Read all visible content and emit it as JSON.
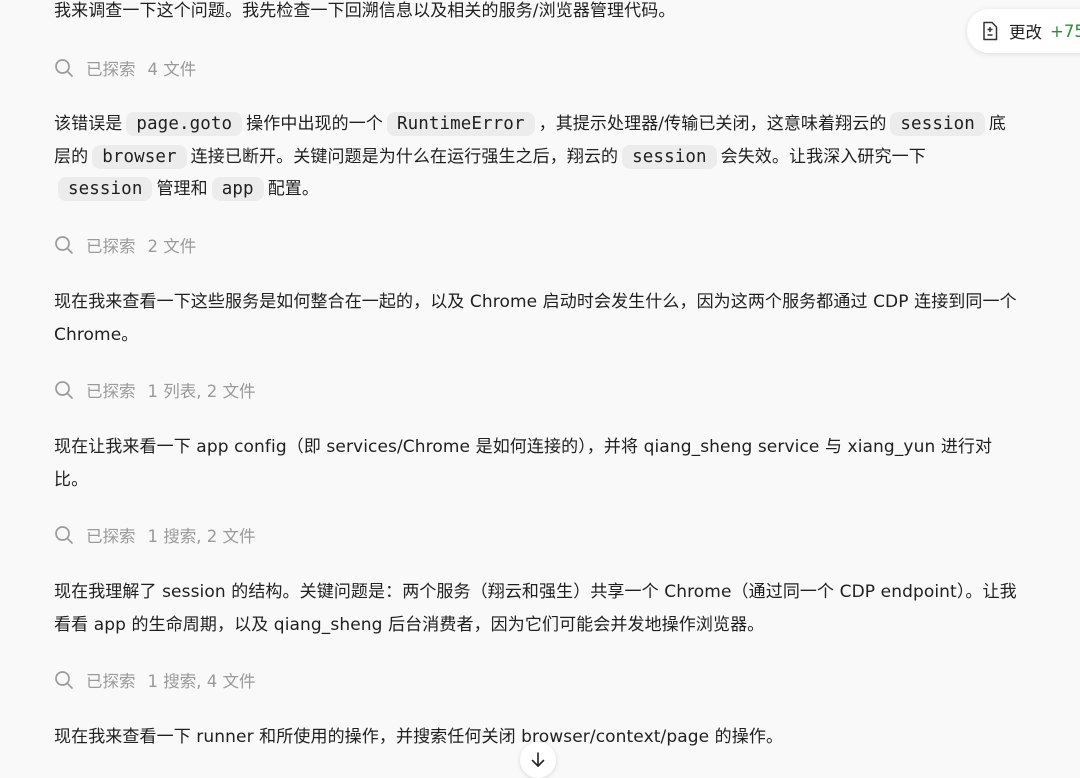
{
  "messages": [
    {
      "parts": [
        {
          "t": "我来调查一下这个问题。我先检查一下回溯信息以及相关的服务/浏览器管理代码。"
        }
      ]
    },
    {
      "parts": [
        {
          "t": "该错误是"
        },
        {
          "c": "page.goto"
        },
        {
          "t": "操作中出现的一个"
        },
        {
          "c": "RuntimeError"
        },
        {
          "t": "，其提示处理器/传输已关闭，这意味着翔云的"
        },
        {
          "c": "session"
        },
        {
          "t": "底层的"
        },
        {
          "c": "browser"
        },
        {
          "t": "连接已断开。关键问题是为什么在运行强生之后，翔云的"
        },
        {
          "c": "session"
        },
        {
          "t": "会失效。让我深入研究一下"
        },
        {
          "c": "session"
        },
        {
          "t": "管理和"
        },
        {
          "c": "app"
        },
        {
          "t": "配置。"
        }
      ]
    },
    {
      "parts": [
        {
          "t": "现在我来查看一下这些服务是如何整合在一起的，以及 Chrome 启动时会发生什么，因为这两个服务都通过 CDP 连接到同一个 Chrome。"
        }
      ]
    },
    {
      "parts": [
        {
          "t": "现在让我来看一下 app config（即 services/Chrome 是如何连接的），并将 qiang_sheng service 与 xiang_yun 进行对比。"
        }
      ]
    },
    {
      "parts": [
        {
          "t": "现在我理解了 session 的结构。关键问题是：两个服务（翔云和强生）共享一个 Chrome（通过同一个 CDP endpoint）。让我看看 app 的生命周期，以及 qiang_sheng 后台消费者，因为它们可能会并发地操作浏览器。"
        }
      ]
    },
    {
      "parts": [
        {
          "t": "现在我来查看一下 runner 和所使用的操作，并搜索任何关闭 browser/context/page 的操作。"
        }
      ]
    }
  ],
  "explorations": [
    {
      "label": "已探索",
      "detail": "4 文件"
    },
    {
      "label": "已探索",
      "detail": "2 文件"
    },
    {
      "label": "已探索",
      "detail": "1 列表, 2 文件"
    },
    {
      "label": "已探索",
      "detail": "1 搜索, 2 文件"
    },
    {
      "label": "已探索",
      "detail": "1 搜索, 4 文件"
    }
  ],
  "changes_button": {
    "label": "更改",
    "count": "+75",
    "icon": "file-diff-icon"
  },
  "scroll_button": {
    "icon": "arrow-down-icon"
  },
  "colors": {
    "background": "#f9f9f9",
    "muted": "#9a9a9a",
    "code_bg": "#ececec",
    "added": "#2f8a3a"
  }
}
